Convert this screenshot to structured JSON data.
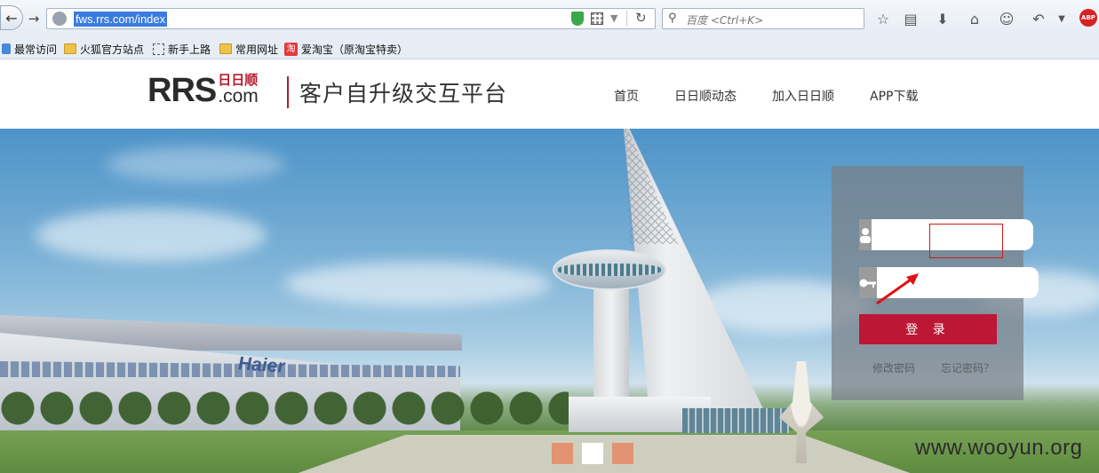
{
  "browser": {
    "url": "fws.rrs.com/index",
    "search_placeholder": "百度 <Ctrl+K>",
    "bookmarks": [
      {
        "label": "最常访问",
        "icon": "star-icon"
      },
      {
        "label": "火狐官方站点",
        "icon": "folder-icon"
      },
      {
        "label": "新手上路",
        "icon": "dashed-page-icon"
      },
      {
        "label": "常用网址",
        "icon": "folder-icon"
      },
      {
        "label": "爱淘宝（原淘宝特卖）",
        "icon": "taobao-icon"
      }
    ],
    "toolbar_icons": [
      "star-icon",
      "reading-list-icon",
      "download-icon",
      "home-icon",
      "smiley-icon",
      "undo-icon",
      "dropdown-icon",
      "adblock-icon"
    ],
    "adblock_label": "ABP"
  },
  "site": {
    "logo_main": "RRS",
    "logo_cn": "日日顺",
    "logo_com": ".com",
    "platform_title": "客户自升级交互平台",
    "nav": [
      "首页",
      "日日顺动态",
      "加入日日顺",
      "APP下载"
    ]
  },
  "banner": {
    "sign_text": "Haier",
    "slides": 3,
    "active_slide": 2
  },
  "login": {
    "username_value": "",
    "password_value": "",
    "login_label": "登 录",
    "change_password": "修改密码",
    "forgot_password": "忘记密码？"
  },
  "watermark": "www.wooyun.org",
  "colors": {
    "brand_red": "#bc1734",
    "dot_inactive": "#e29372",
    "dot_active": "#ffffff",
    "highlight": "#d01a1a"
  }
}
